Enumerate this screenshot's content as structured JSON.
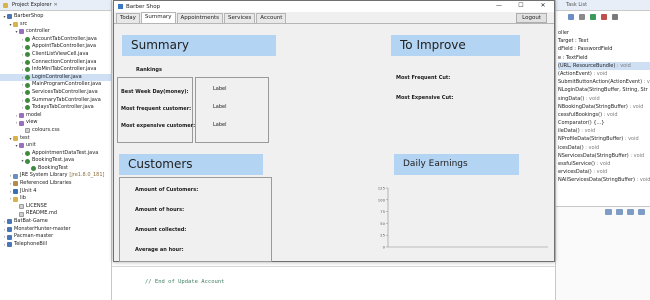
{
  "explorer": {
    "tab_label": "Project Explorer",
    "items": [
      {
        "label": "BarberShop"
      },
      {
        "label": "src"
      },
      {
        "label": "controller"
      },
      {
        "label": "AccountTabController.java"
      },
      {
        "label": "AppointTabController.java"
      },
      {
        "label": "ClientListViewCell.java"
      },
      {
        "label": "ConnectionController.java"
      },
      {
        "label": "InfoMiniTabController.java"
      },
      {
        "label": "LoginController.java"
      },
      {
        "label": "MainProgramController.java"
      },
      {
        "label": "ServicesTabController.java"
      },
      {
        "label": "SummaryTabController.java"
      },
      {
        "label": "TodaysTabController.java"
      },
      {
        "label": "model"
      },
      {
        "label": "view"
      },
      {
        "label": "colours.css"
      },
      {
        "label": "test"
      },
      {
        "label": "unit"
      },
      {
        "label": "AppointmentDataTest.java"
      },
      {
        "label": "BookingTest.java"
      },
      {
        "label": "BookingTest"
      },
      {
        "label": "JRE System Library",
        "suffix": "[jre1.8.0_181]"
      },
      {
        "label": "Referenced Libraries"
      },
      {
        "label": "JUnit 4"
      },
      {
        "label": "lib"
      },
      {
        "label": "LICENSE"
      },
      {
        "label": "README.md"
      },
      {
        "label": "BatBat-Game"
      },
      {
        "label": "MonsterHunter-master"
      },
      {
        "label": "Pacman-master"
      },
      {
        "label": "TelephoneBill"
      }
    ]
  },
  "outline": {
    "tab_label": "Task List",
    "lines": [
      {
        "text": "oller",
        "ret": ""
      },
      {
        "text": "Target : Text",
        "ret": ""
      },
      {
        "text": "dField : PasswordField",
        "ret": ""
      },
      {
        "text": "e : TextField",
        "ret": ""
      },
      {
        "text": "(URL, ResourceBundle)",
        "ret": " : void"
      },
      {
        "text": "(ActionEvent)",
        "ret": " : void"
      },
      {
        "text": "SubmitButtonAction(ActionEvent)",
        "ret": " : void"
      },
      {
        "text": "NLoginData(StringBuffer, String, Str",
        "ret": ""
      },
      {
        "text": "singData()",
        "ret": " : void"
      },
      {
        "text": "NBookingData(StringBuffer)",
        "ret": " : void"
      },
      {
        "text": "cessfulBookings()",
        "ret": " : void"
      },
      {
        "text": "Comparator() {...}",
        "ret": ""
      },
      {
        "text": "ileData()",
        "ret": " : void"
      },
      {
        "text": "NProfileData(StringBuffer)",
        "ret": " : void"
      },
      {
        "text": "icesData()",
        "ret": " : void"
      },
      {
        "text": "NServicesData(StringBuffer)",
        "ret": " : void"
      },
      {
        "text": "essfulService()",
        "ret": " : void"
      },
      {
        "text": "ervicesData()",
        "ret": " : void"
      },
      {
        "text": "NAllServicesData(StringBuffer)",
        "ret": " : void"
      }
    ]
  },
  "code": {
    "line": "// End of Update Account"
  },
  "window": {
    "title": "Barber Shop",
    "minimize": "—",
    "maximize": "☐",
    "close": "✕"
  },
  "tabs": [
    {
      "label": "Today"
    },
    {
      "label": "Summary"
    },
    {
      "label": "Appointments"
    },
    {
      "label": "Services"
    },
    {
      "label": "Account"
    }
  ],
  "logout_label": "Logout",
  "summary": {
    "title": "Summary",
    "rankings_title": "Rankings",
    "rows": [
      {
        "label": "Best Week Day(money):",
        "value": "Label"
      },
      {
        "label": "Most frequent customer:",
        "value": "Label"
      },
      {
        "label": "Most expensive customer:",
        "value": "Label"
      }
    ]
  },
  "improve": {
    "title": "To Improve",
    "rows": [
      {
        "label": "Most Frequent Cut:"
      },
      {
        "label": "Most Expensive Cut:"
      }
    ]
  },
  "customers": {
    "title": "Customers",
    "rows": [
      {
        "label": "Amount of Customers:"
      },
      {
        "label": "Amount of hours:"
      },
      {
        "label": "Amount collected:"
      },
      {
        "label": "Average an hour:"
      }
    ]
  },
  "earnings": {
    "title": "Daily Earnings"
  },
  "chart_data": {
    "type": "bar",
    "title": "",
    "categories": [],
    "values": [],
    "ylim": [
      0,
      125
    ],
    "yticks": [
      "0",
      "25",
      "50",
      "75",
      "100",
      "125"
    ],
    "grid": false
  },
  "colors": {
    "section_header": "#b3d4f2",
    "window_bg": "#f0f0f0"
  }
}
